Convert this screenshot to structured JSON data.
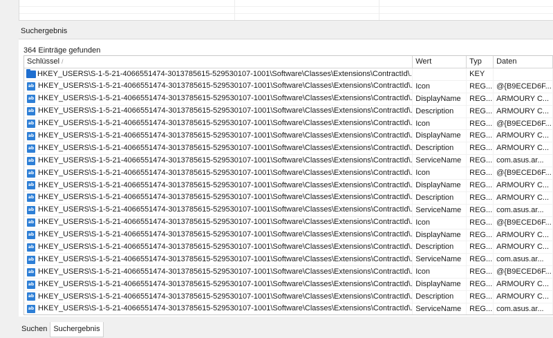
{
  "panel": {
    "title": "Suchergebnis",
    "count_text": "364 Einträge gefunden"
  },
  "columns": {
    "key": "Schlüssel",
    "value": "Wert",
    "type": "Typ",
    "data": "Daten"
  },
  "sort_indicator": "/",
  "icons": {
    "folder": "folder-icon",
    "value": "registry-value-icon",
    "value_glyph": "ab"
  },
  "rows": [
    {
      "icon": "folder",
      "key": "HKEY_USERS\\S-1-5-21-4066551474-3013785615-529530107-1001\\Software\\Classes\\Extensions\\ContractId\\...",
      "value": "",
      "type": "KEY",
      "data": ""
    },
    {
      "icon": "value",
      "key": "HKEY_USERS\\S-1-5-21-4066551474-3013785615-529530107-1001\\Software\\Classes\\Extensions\\ContractId\\...",
      "value": "Icon",
      "type": "REG...",
      "data": "@{B9ECED6F..."
    },
    {
      "icon": "value",
      "key": "HKEY_USERS\\S-1-5-21-4066551474-3013785615-529530107-1001\\Software\\Classes\\Extensions\\ContractId\\...",
      "value": "DisplayName",
      "type": "REG...",
      "data": "ARMOURY C..."
    },
    {
      "icon": "value",
      "key": "HKEY_USERS\\S-1-5-21-4066551474-3013785615-529530107-1001\\Software\\Classes\\Extensions\\ContractId\\...",
      "value": "Description",
      "type": "REG...",
      "data": "ARMOURY C..."
    },
    {
      "icon": "value",
      "key": "HKEY_USERS\\S-1-5-21-4066551474-3013785615-529530107-1001\\Software\\Classes\\Extensions\\ContractId\\...",
      "value": "Icon",
      "type": "REG...",
      "data": "@{B9ECED6F..."
    },
    {
      "icon": "value",
      "key": "HKEY_USERS\\S-1-5-21-4066551474-3013785615-529530107-1001\\Software\\Classes\\Extensions\\ContractId\\...",
      "value": "DisplayName",
      "type": "REG...",
      "data": "ARMOURY C..."
    },
    {
      "icon": "value",
      "key": "HKEY_USERS\\S-1-5-21-4066551474-3013785615-529530107-1001\\Software\\Classes\\Extensions\\ContractId\\...",
      "value": "Description",
      "type": "REG...",
      "data": "ARMOURY C..."
    },
    {
      "icon": "value",
      "key": "HKEY_USERS\\S-1-5-21-4066551474-3013785615-529530107-1001\\Software\\Classes\\Extensions\\ContractId\\...",
      "value": "ServiceName",
      "type": "REG...",
      "data": "com.asus.ar..."
    },
    {
      "icon": "value",
      "key": "HKEY_USERS\\S-1-5-21-4066551474-3013785615-529530107-1001\\Software\\Classes\\Extensions\\ContractId\\...",
      "value": "Icon",
      "type": "REG...",
      "data": "@{B9ECED6F..."
    },
    {
      "icon": "value",
      "key": "HKEY_USERS\\S-1-5-21-4066551474-3013785615-529530107-1001\\Software\\Classes\\Extensions\\ContractId\\...",
      "value": "DisplayName",
      "type": "REG...",
      "data": "ARMOURY C..."
    },
    {
      "icon": "value",
      "key": "HKEY_USERS\\S-1-5-21-4066551474-3013785615-529530107-1001\\Software\\Classes\\Extensions\\ContractId\\...",
      "value": "Description",
      "type": "REG...",
      "data": "ARMOURY C..."
    },
    {
      "icon": "value",
      "key": "HKEY_USERS\\S-1-5-21-4066551474-3013785615-529530107-1001\\Software\\Classes\\Extensions\\ContractId\\...",
      "value": "ServiceName",
      "type": "REG...",
      "data": "com.asus.ar..."
    },
    {
      "icon": "value",
      "key": "HKEY_USERS\\S-1-5-21-4066551474-3013785615-529530107-1001\\Software\\Classes\\Extensions\\ContractId\\...",
      "value": "Icon",
      "type": "REG...",
      "data": "@{B9ECED6F..."
    },
    {
      "icon": "value",
      "key": "HKEY_USERS\\S-1-5-21-4066551474-3013785615-529530107-1001\\Software\\Classes\\Extensions\\ContractId\\...",
      "value": "DisplayName",
      "type": "REG...",
      "data": "ARMOURY C..."
    },
    {
      "icon": "value",
      "key": "HKEY_USERS\\S-1-5-21-4066551474-3013785615-529530107-1001\\Software\\Classes\\Extensions\\ContractId\\...",
      "value": "Description",
      "type": "REG...",
      "data": "ARMOURY C..."
    },
    {
      "icon": "value",
      "key": "HKEY_USERS\\S-1-5-21-4066551474-3013785615-529530107-1001\\Software\\Classes\\Extensions\\ContractId\\...",
      "value": "ServiceName",
      "type": "REG...",
      "data": "com.asus.ar..."
    },
    {
      "icon": "value",
      "key": "HKEY_USERS\\S-1-5-21-4066551474-3013785615-529530107-1001\\Software\\Classes\\Extensions\\ContractId\\...",
      "value": "Icon",
      "type": "REG...",
      "data": "@{B9ECED6F..."
    },
    {
      "icon": "value",
      "key": "HKEY_USERS\\S-1-5-21-4066551474-3013785615-529530107-1001\\Software\\Classes\\Extensions\\ContractId\\...",
      "value": "DisplayName",
      "type": "REG...",
      "data": "ARMOURY C..."
    },
    {
      "icon": "value",
      "key": "HKEY_USERS\\S-1-5-21-4066551474-3013785615-529530107-1001\\Software\\Classes\\Extensions\\ContractId\\...",
      "value": "Description",
      "type": "REG...",
      "data": "ARMOURY C..."
    },
    {
      "icon": "value",
      "key": "HKEY_USERS\\S-1-5-21-4066551474-3013785615-529530107-1001\\Software\\Classes\\Extensions\\ContractId\\...",
      "value": "ServiceName",
      "type": "REG...",
      "data": "com.asus.ar..."
    }
  ],
  "tabs": [
    {
      "label": "Suchen",
      "active": false
    },
    {
      "label": "Suchergebnis",
      "active": true
    }
  ],
  "colors": {
    "accent": "#1f6fd0",
    "window_bg": "#f0f0f0",
    "grid_bg": "#ffffff"
  }
}
